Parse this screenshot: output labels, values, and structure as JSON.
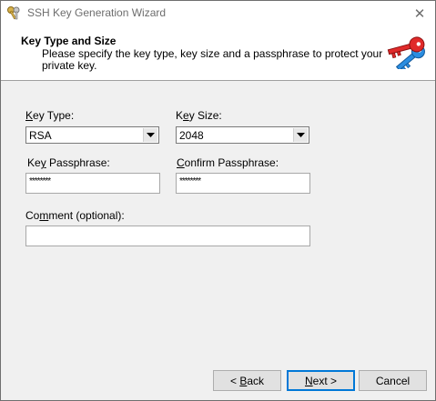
{
  "window": {
    "title": "SSH Key Generation Wizard",
    "close_glyph": "✕"
  },
  "header": {
    "title": "Key Type and Size",
    "description": "Please specify the key type, key size and a passphrase to protect your private key."
  },
  "form": {
    "key_type": {
      "label_underline": "K",
      "label_rest": "ey Type:",
      "value": "RSA"
    },
    "key_size": {
      "label_prefix": "K",
      "label_underline": "e",
      "label_rest": "y Size:",
      "value": "2048"
    },
    "key_passphrase": {
      "label_prefix": "Ke",
      "label_underline": "y",
      "label_rest": " Passphrase:",
      "value": "********"
    },
    "confirm_passphrase": {
      "label_underline": "C",
      "label_rest": "onfirm Passphrase:",
      "value": "********"
    },
    "comment": {
      "label_prefix": "Co",
      "label_underline": "m",
      "label_rest": "ment (optional):",
      "value": ""
    }
  },
  "buttons": {
    "back": {
      "prefix": "< ",
      "underline": "B",
      "rest": "ack"
    },
    "next": {
      "underline": "N",
      "rest": "ext >"
    },
    "cancel": {
      "label": "Cancel"
    }
  },
  "icons": {
    "app": "keys-icon",
    "header": "keys-icon",
    "close": "close-icon",
    "dropdown": "chevron-down-icon"
  }
}
